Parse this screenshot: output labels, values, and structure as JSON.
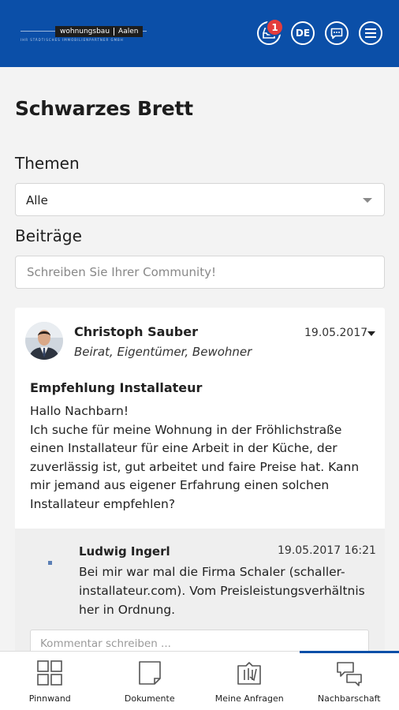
{
  "app": {
    "logo": {
      "word_left": "wohnungsbau",
      "word_right": "Aalen",
      "tagline": "IHR STÄDTISCHES IMMOBILIENPARTNER GMBH"
    },
    "topbar_icons": [
      {
        "name": "inbox-icon",
        "badge": "1"
      },
      {
        "name": "language-toggle",
        "label": "DE"
      },
      {
        "name": "chat-icon"
      },
      {
        "name": "menu-icon"
      }
    ],
    "accent_color": "#0b4fa8",
    "badge_color": "#e43d3d"
  },
  "page": {
    "title": "Schwarzes Brett",
    "topics_label": "Themen",
    "topics_selected": "Alle",
    "posts_label": "Beiträge",
    "composer_placeholder": "Schreiben Sie Ihrer Community!"
  },
  "post": {
    "author": "Christoph Sauber",
    "roles": "Beirat, Eigentümer, Bewohner",
    "date": "19.05.2017",
    "title": "Empfehlung Installateur",
    "greeting": "Hallo Nachbarn!",
    "body": "Ich suche für meine Wohnung in der Fröhlichstraße einen Installateur für eine Arbeit in der Küche, der zuverlässig ist, gut arbeitet und faire Preise hat. Kann mir jemand aus eigener Erfahrung einen solchen Installateur empfehlen?",
    "comment": {
      "author": "Ludwig Ingerl",
      "datetime": "19.05.2017 16:21",
      "text": "Bei mir war mal die Firma Schaler (schaller-installateur.com). Vom Preisleistungsverhältnis her in Ordnung."
    },
    "comment_placeholder": "Kommentar schreiben ..."
  },
  "bottom_nav": [
    {
      "label": "Pinnwand",
      "icon": "grid-icon"
    },
    {
      "label": "Dokumente",
      "icon": "document-icon"
    },
    {
      "label": "Meine Anfragen",
      "icon": "requests-icon"
    },
    {
      "label": "Nachbarschaft",
      "icon": "neighborhood-chat-icon",
      "active": true
    }
  ]
}
